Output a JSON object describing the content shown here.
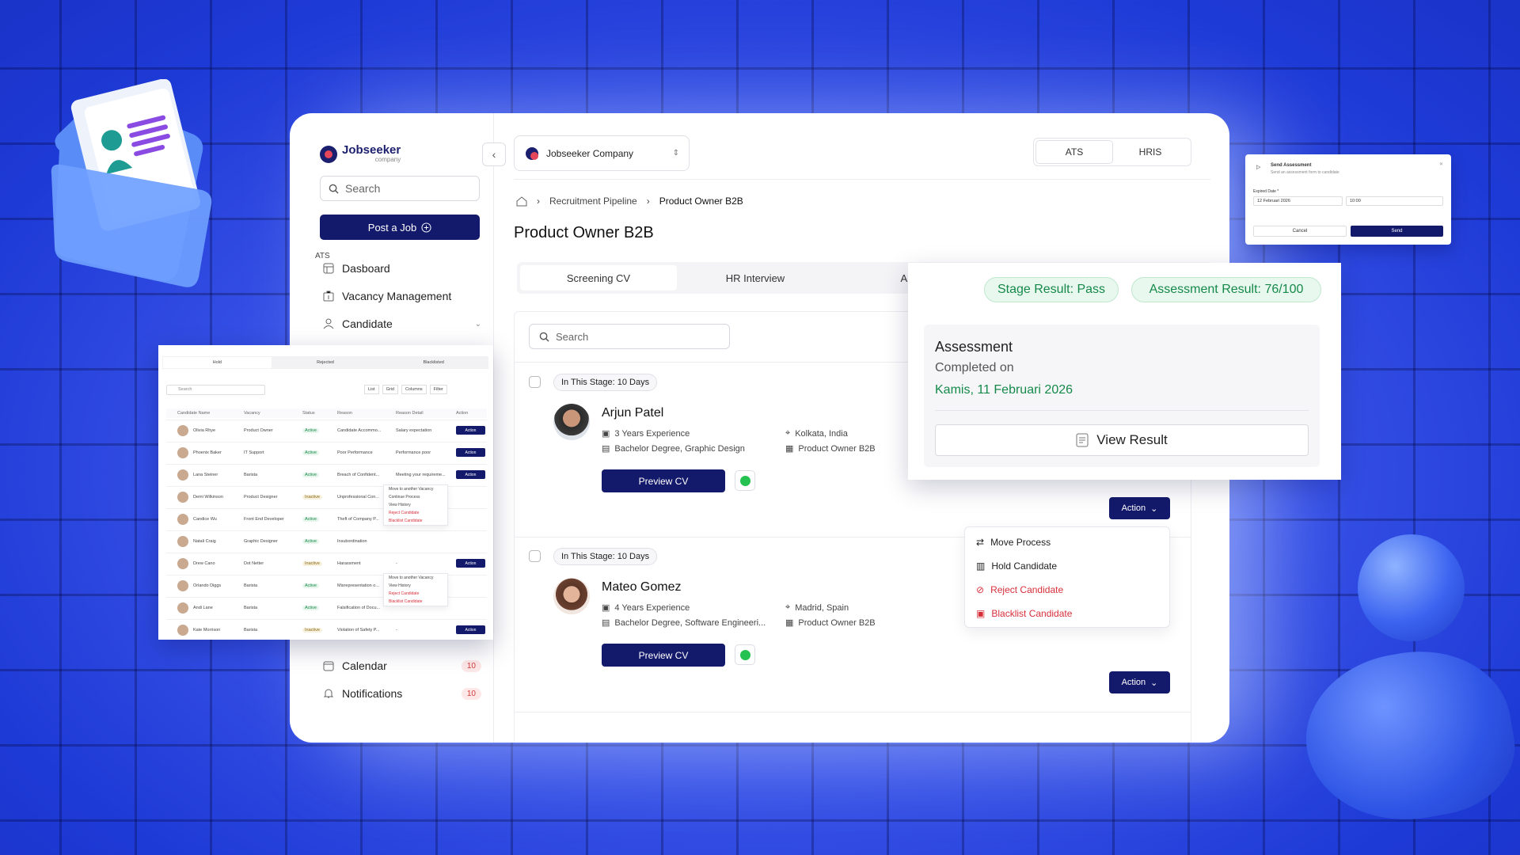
{
  "brand": {
    "name": "Jobseeker",
    "sub": "company"
  },
  "sidebar": {
    "search_placeholder": "Search",
    "post_job": "Post a Job",
    "section": "ATS",
    "items": [
      {
        "label": "Dasboard"
      },
      {
        "label": "Vacancy Management"
      },
      {
        "label": "Candidate"
      },
      {
        "label": "Calendar",
        "badge": "10"
      },
      {
        "label": "Notifications",
        "badge": "10"
      }
    ]
  },
  "header": {
    "company": "Jobseeker Company",
    "modes": [
      "ATS",
      "HRIS"
    ]
  },
  "breadcrumb": [
    "Recruitment Pipeline",
    "Product Owner B2B"
  ],
  "page_title": "Product Owner B2B",
  "tabs": [
    "Screening CV",
    "HR Interview",
    "Asse"
  ],
  "main_search_placeholder": "Search",
  "candidates": [
    {
      "stage": "In This Stage: 10 Days",
      "name": "Arjun Patel",
      "experience": "3 Years Experience",
      "education": "Bachelor Degree, Graphic Design",
      "location": "Kolkata, India",
      "vacancy": "Product Owner B2B",
      "preview": "Preview CV",
      "action": "Action"
    },
    {
      "stage": "In This Stage: 10 Days",
      "name": "Mateo Gomez",
      "experience": "4 Years Experience",
      "education": "Bachelor Degree, Software Engineeri...",
      "location": "Madrid, Spain",
      "vacancy": "Product Owner B2B",
      "preview": "Preview CV",
      "action": "Action"
    }
  ],
  "action_menu": [
    "Move Process",
    "Hold Candidate",
    "Reject Candidate",
    "Blacklist Candidate"
  ],
  "assessment": {
    "stage_result": "Stage Result: Pass",
    "assessment_result": "Assessment Result: 76/100",
    "title": "Assessment",
    "completed_label": "Completed on",
    "completed_date": "Kamis, 11 Februari 2026",
    "view_result": "View Result"
  },
  "send_modal": {
    "title": "Send Assessment",
    "subtitle": "Send an assessment form to candidate",
    "field_label": "Expired Date *",
    "date": "12 Februari 2026",
    "time": "10:00",
    "cancel": "Cancel",
    "send": "Send"
  },
  "list_card": {
    "tabs": [
      "Hold",
      "Rejected",
      "Blacklisted"
    ],
    "search": "Search",
    "views": [
      "List",
      "Grid",
      "Columns",
      "Filter"
    ],
    "columns": [
      "Candidate Name",
      "Vacancy",
      "Status",
      "Reason",
      "Reason Detail",
      "Action"
    ],
    "rows": [
      {
        "name": "Olivia Rhye",
        "vacancy": "Product Owner",
        "status": "Active",
        "reason": "Candidate Accommo...",
        "detail": "Salary expectation",
        "action": true
      },
      {
        "name": "Phoenix Baker",
        "vacancy": "IT Support",
        "status": "Active",
        "reason": "Poor Performance",
        "detail": "Performance poor",
        "action": true
      },
      {
        "name": "Lana Steiner",
        "vacancy": "Barista",
        "status": "Active",
        "reason": "Breach of Confident...",
        "detail": "Meeting your requireme...",
        "action": true
      },
      {
        "name": "Demi Wilkinson",
        "vacancy": "Product Designer",
        "status": "Inactive",
        "reason": "Unprofessional Con...",
        "detail": "",
        "action": false
      },
      {
        "name": "Candice Wu",
        "vacancy": "Front End Developer",
        "status": "Active",
        "reason": "Theft of Company P...",
        "detail": "",
        "action": false
      },
      {
        "name": "Natali Craig",
        "vacancy": "Graphic Designer",
        "status": "Active",
        "reason": "Insubordination",
        "detail": "",
        "action": false
      },
      {
        "name": "Drew Cano",
        "vacancy": "Dot Netter",
        "status": "Inactive",
        "reason": "Harassment",
        "detail": "-",
        "action": true
      },
      {
        "name": "Orlando Diggs",
        "vacancy": "Barista",
        "status": "Active",
        "reason": "Misrepresentation o...",
        "detail": "",
        "action": false
      },
      {
        "name": "Andi Lane",
        "vacancy": "Barista",
        "status": "Active",
        "reason": "Falsification of Docu...",
        "detail": "",
        "action": false
      },
      {
        "name": "Kate Morrison",
        "vacancy": "Barista",
        "status": "Inactive",
        "reason": "Violation of Safety P...",
        "detail": "-",
        "action": true
      }
    ],
    "row_action": "Action",
    "popup1": [
      "Move to another Vacancy",
      "Continue Process",
      "View History",
      "Reject Candidate",
      "Blacklist Candidate"
    ],
    "popup2": [
      "Move to another Vacancy",
      "View History",
      "Reject Candidate",
      "Blacklist Candidate"
    ]
  },
  "colors": {
    "primary": "#141a6b",
    "accent_red": "#e4465a",
    "success": "#15894a",
    "background": "#2f4ce4"
  }
}
